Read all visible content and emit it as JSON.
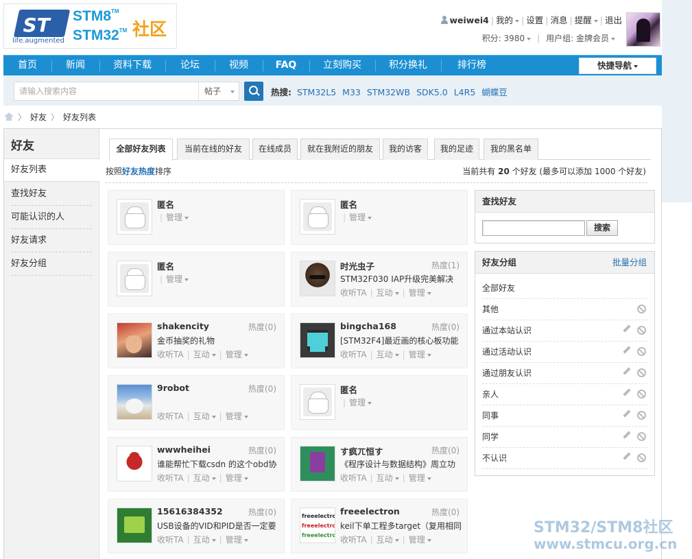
{
  "logo": {
    "brand": "ST",
    "tagline": "life.augmented",
    "stm8": "STM8",
    "stm32": "STM32",
    "tm": "TM",
    "community": "社区"
  },
  "userbar": {
    "username": "weiwei4",
    "links": [
      "我的",
      "设置",
      "消息",
      "提醒",
      "退出"
    ],
    "points": "积分: 3980",
    "usergroup": "用户组: 金牌会员"
  },
  "nav": {
    "items": [
      "首页",
      "新闻",
      "资料下载",
      "论坛",
      "视频",
      "FAQ",
      "立刻购买",
      "积分换礼",
      "排行榜"
    ],
    "quick_nav": "快捷导航"
  },
  "search": {
    "placeholder": "请输入搜索内容",
    "type": "帖子",
    "hot_label": "热搜:",
    "hot_tags": [
      "STM32L5",
      "M33",
      "STM32WB",
      "SDK5.0",
      "L4R5",
      "蝴蝶豆"
    ]
  },
  "breadcrumb": [
    "好友",
    "好友列表"
  ],
  "sidebar": {
    "title": "好友",
    "items": [
      "好友列表",
      "查找好友",
      "可能认识的人",
      "好友请求",
      "好友分组"
    ]
  },
  "tabs": [
    "全部好友列表",
    "当前在线的好友",
    "在线成员",
    "就在我附近的朋友",
    "我的访客",
    "我的足迹",
    "我的黑名单"
  ],
  "sort": {
    "prefix": "按照",
    "key": "好友热度",
    "suffix": "排序"
  },
  "count": {
    "prefix": "当前共有",
    "num": "20",
    "suffix": "个好友 (最多可以添加 1000 个好友)"
  },
  "action_labels": {
    "listen": "收听TA",
    "interact": "互动",
    "manage": "管理"
  },
  "friends": [
    {
      "name": "匿名",
      "heat": "",
      "msg": "",
      "avatar": "anonymous-avatar",
      "listen": false
    },
    {
      "name": "匿名",
      "heat": "",
      "msg": "",
      "avatar": "anonymous-avatar",
      "listen": false
    },
    {
      "name": "匿名",
      "heat": "",
      "msg": "",
      "avatar": "anonymous-avatar",
      "listen": false
    },
    {
      "name": "时光虫子",
      "heat": "热度(1)",
      "msg": "STM32F030 IAP升级完美解决",
      "avatar": "sunglasses-avatar",
      "listen": true
    },
    {
      "name": "shakencity",
      "heat": "热度(0)",
      "msg": "金币抽奖的礼物",
      "avatar": "anime-avatar",
      "listen": true
    },
    {
      "name": "bingcha168",
      "heat": "热度(0)",
      "msg": "[STM32F4]最近画的核心板功能",
      "avatar": "robot-avatar",
      "listen": true
    },
    {
      "name": "9robot",
      "heat": "热度(0)",
      "msg": "",
      "avatar": "cat-avatar",
      "listen": true
    },
    {
      "name": "匿名",
      "heat": "",
      "msg": "",
      "avatar": "anonymous-avatar",
      "listen": false
    },
    {
      "name": "wwwheihei",
      "heat": "热度(0)",
      "msg": "谁能帮忙下载csdn 的这个obd协",
      "avatar": "toy-avatar",
      "listen": true
    },
    {
      "name": "す疯ㄫ恒す",
      "heat": "热度(0)",
      "msg": "《程序设计与数据结构》周立功",
      "avatar": "pixel-avatar",
      "listen": true
    },
    {
      "name": "15616384352",
      "heat": "热度(0)",
      "msg": "USB设备的VID和PID是否一定要",
      "avatar": "invader-avatar",
      "listen": true
    },
    {
      "name": "freeelectron",
      "heat": "热度(0)",
      "msg": "keil下单工程多target（复用相同",
      "avatar": "freeelectron-avatar",
      "listen": true
    }
  ],
  "freeelectron_logo": "freeelectron",
  "find_box": {
    "title": "查找好友",
    "button": "搜索"
  },
  "groups_box": {
    "title": "好友分组",
    "action": "批量分组",
    "all": "全部好友",
    "groups": [
      {
        "name": "其他",
        "editable": false
      },
      {
        "name": "通过本站认识",
        "editable": true
      },
      {
        "name": "通过活动认识",
        "editable": true
      },
      {
        "name": "通过朋友认识",
        "editable": true
      },
      {
        "name": "亲人",
        "editable": true
      },
      {
        "name": "同事",
        "editable": true
      },
      {
        "name": "同学",
        "editable": true
      },
      {
        "name": "不认识",
        "editable": true
      }
    ]
  },
  "watermark": {
    "line1": "STM32/STM8社区",
    "line2": "www.stmcu.org.cn"
  }
}
